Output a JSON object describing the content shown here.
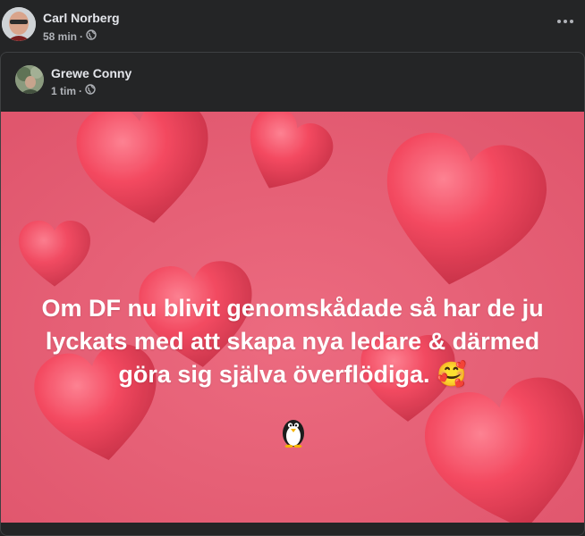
{
  "post": {
    "author": "Carl Norberg",
    "time": "58 min",
    "privacy_icon": "globe-icon",
    "menu_icon": "more-options-icon"
  },
  "shared_post": {
    "author": "Grewe Conny",
    "time": "1 tim",
    "privacy_icon": "globe-icon",
    "text": "Om DF nu blivit genomskådade så har de ju lyckats med att skapa nya ledare & därmed göra sig själva överflödiga. 🥰",
    "emoji_below": "penguin-icon",
    "background_theme": "hearts",
    "colors": {
      "background": "#e65c73",
      "heart": "#f0485f",
      "text": "#ffffff"
    }
  }
}
